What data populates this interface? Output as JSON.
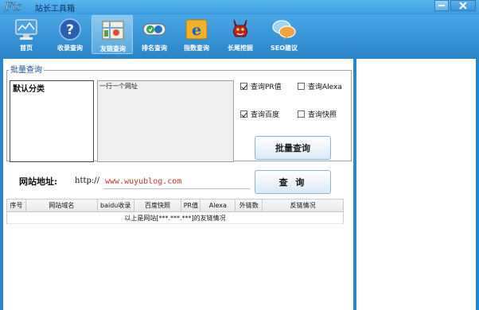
{
  "app": {
    "logo_text": "Fis",
    "title": "站长工具箱"
  },
  "toolbar": {
    "items": [
      {
        "label": "首页",
        "icon": "monitor-icon"
      },
      {
        "label": "收录查询",
        "icon": "help-icon"
      },
      {
        "label": "友链查询",
        "icon": "map-icon",
        "active": true
      },
      {
        "label": "排名查询",
        "icon": "ranking-icon"
      },
      {
        "label": "指数查询",
        "icon": "ie-icon"
      },
      {
        "label": "长尾挖掘",
        "icon": "devil-icon"
      },
      {
        "label": "SEO建议",
        "icon": "chat-icon"
      }
    ]
  },
  "batch": {
    "group_title": "批量查询",
    "category": "默认分类",
    "url_placeholder": "一行一个网址",
    "options": {
      "pr": {
        "label": "查询PR值",
        "checked": true
      },
      "alexa": {
        "label": "查询Alexa",
        "checked": false
      },
      "baidu": {
        "label": "查询百度",
        "checked": true
      },
      "snapshot": {
        "label": "查询快照",
        "checked": false
      }
    },
    "button": "批量查询"
  },
  "site": {
    "label": "网站地址:",
    "prefix": "http://",
    "value": "www.wuyublog.com",
    "button": "查 询"
  },
  "table": {
    "columns": [
      "序号",
      "网站域名",
      "baidu收录",
      "百度快照",
      "PR值",
      "Alexa",
      "外链数",
      "反链情况"
    ],
    "summary_row": "以上是网站[***.***.***]的友链情况"
  },
  "colors": {
    "titlebar": "#3a9be0",
    "toolbar": "#2a86c9",
    "group_title": "#1a4e9a",
    "input_text": "#c0392b"
  }
}
